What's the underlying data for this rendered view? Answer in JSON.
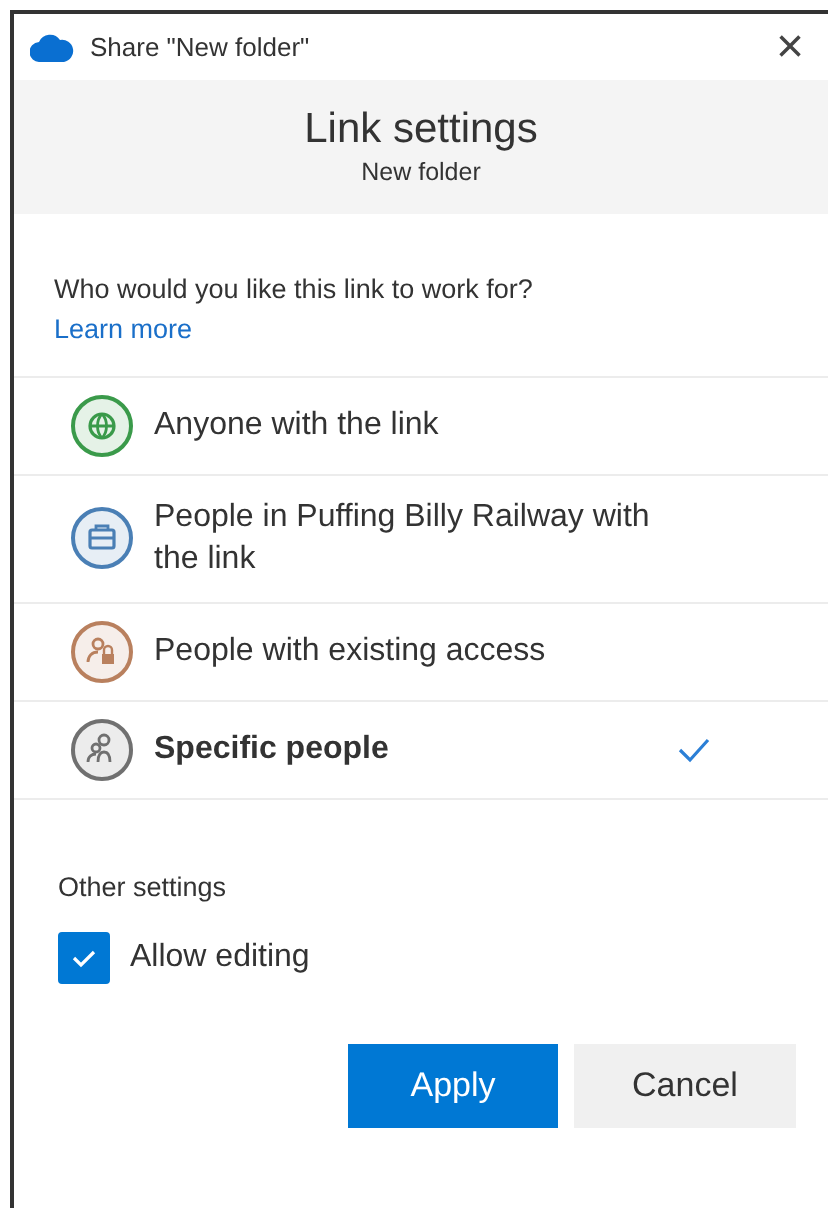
{
  "window": {
    "title": "Share \"New folder\"",
    "close": "×"
  },
  "header": {
    "title": "Link settings",
    "subtitle": "New folder"
  },
  "question": "Who would you like this link to work for?",
  "learn_more": "Learn more",
  "options": [
    {
      "kind": "globe",
      "color": "#3a9a4a",
      "label": "Anyone with the link",
      "selected": false
    },
    {
      "kind": "briefcase",
      "color": "#4a7fb5",
      "label": "People in Puffing Billy Railway with the link",
      "selected": false
    },
    {
      "kind": "people-lock",
      "color": "#b9805e",
      "label": "People with existing access",
      "selected": false
    },
    {
      "kind": "people",
      "color": "#707070",
      "label": "Specific people",
      "selected": true
    }
  ],
  "other_settings": {
    "title": "Other settings",
    "checkbox": {
      "label": "Allow editing",
      "checked": true
    }
  },
  "buttons": [
    {
      "kind": "primary",
      "label": "Apply"
    },
    {
      "kind": "secondary",
      "label": "Cancel"
    }
  ]
}
